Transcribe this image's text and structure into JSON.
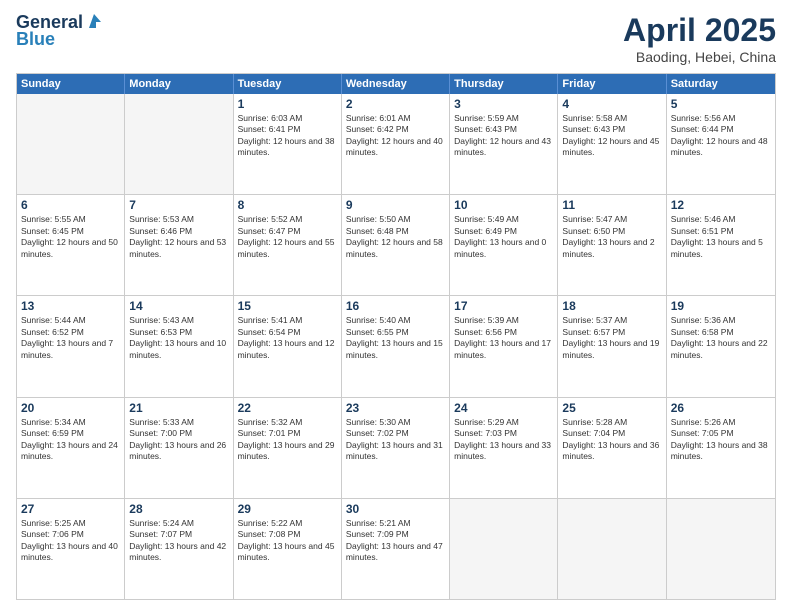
{
  "header": {
    "logo_line1": "General",
    "logo_line2": "Blue",
    "month_title": "April 2025",
    "location": "Baoding, Hebei, China"
  },
  "days_of_week": [
    "Sunday",
    "Monday",
    "Tuesday",
    "Wednesday",
    "Thursday",
    "Friday",
    "Saturday"
  ],
  "weeks": [
    [
      {
        "day": "",
        "empty": true
      },
      {
        "day": "",
        "empty": true
      },
      {
        "day": "1",
        "sunrise": "Sunrise: 6:03 AM",
        "sunset": "Sunset: 6:41 PM",
        "daylight": "Daylight: 12 hours and 38 minutes."
      },
      {
        "day": "2",
        "sunrise": "Sunrise: 6:01 AM",
        "sunset": "Sunset: 6:42 PM",
        "daylight": "Daylight: 12 hours and 40 minutes."
      },
      {
        "day": "3",
        "sunrise": "Sunrise: 5:59 AM",
        "sunset": "Sunset: 6:43 PM",
        "daylight": "Daylight: 12 hours and 43 minutes."
      },
      {
        "day": "4",
        "sunrise": "Sunrise: 5:58 AM",
        "sunset": "Sunset: 6:43 PM",
        "daylight": "Daylight: 12 hours and 45 minutes."
      },
      {
        "day": "5",
        "sunrise": "Sunrise: 5:56 AM",
        "sunset": "Sunset: 6:44 PM",
        "daylight": "Daylight: 12 hours and 48 minutes."
      }
    ],
    [
      {
        "day": "6",
        "sunrise": "Sunrise: 5:55 AM",
        "sunset": "Sunset: 6:45 PM",
        "daylight": "Daylight: 12 hours and 50 minutes."
      },
      {
        "day": "7",
        "sunrise": "Sunrise: 5:53 AM",
        "sunset": "Sunset: 6:46 PM",
        "daylight": "Daylight: 12 hours and 53 minutes."
      },
      {
        "day": "8",
        "sunrise": "Sunrise: 5:52 AM",
        "sunset": "Sunset: 6:47 PM",
        "daylight": "Daylight: 12 hours and 55 minutes."
      },
      {
        "day": "9",
        "sunrise": "Sunrise: 5:50 AM",
        "sunset": "Sunset: 6:48 PM",
        "daylight": "Daylight: 12 hours and 58 minutes."
      },
      {
        "day": "10",
        "sunrise": "Sunrise: 5:49 AM",
        "sunset": "Sunset: 6:49 PM",
        "daylight": "Daylight: 13 hours and 0 minutes."
      },
      {
        "day": "11",
        "sunrise": "Sunrise: 5:47 AM",
        "sunset": "Sunset: 6:50 PM",
        "daylight": "Daylight: 13 hours and 2 minutes."
      },
      {
        "day": "12",
        "sunrise": "Sunrise: 5:46 AM",
        "sunset": "Sunset: 6:51 PM",
        "daylight": "Daylight: 13 hours and 5 minutes."
      }
    ],
    [
      {
        "day": "13",
        "sunrise": "Sunrise: 5:44 AM",
        "sunset": "Sunset: 6:52 PM",
        "daylight": "Daylight: 13 hours and 7 minutes."
      },
      {
        "day": "14",
        "sunrise": "Sunrise: 5:43 AM",
        "sunset": "Sunset: 6:53 PM",
        "daylight": "Daylight: 13 hours and 10 minutes."
      },
      {
        "day": "15",
        "sunrise": "Sunrise: 5:41 AM",
        "sunset": "Sunset: 6:54 PM",
        "daylight": "Daylight: 13 hours and 12 minutes."
      },
      {
        "day": "16",
        "sunrise": "Sunrise: 5:40 AM",
        "sunset": "Sunset: 6:55 PM",
        "daylight": "Daylight: 13 hours and 15 minutes."
      },
      {
        "day": "17",
        "sunrise": "Sunrise: 5:39 AM",
        "sunset": "Sunset: 6:56 PM",
        "daylight": "Daylight: 13 hours and 17 minutes."
      },
      {
        "day": "18",
        "sunrise": "Sunrise: 5:37 AM",
        "sunset": "Sunset: 6:57 PM",
        "daylight": "Daylight: 13 hours and 19 minutes."
      },
      {
        "day": "19",
        "sunrise": "Sunrise: 5:36 AM",
        "sunset": "Sunset: 6:58 PM",
        "daylight": "Daylight: 13 hours and 22 minutes."
      }
    ],
    [
      {
        "day": "20",
        "sunrise": "Sunrise: 5:34 AM",
        "sunset": "Sunset: 6:59 PM",
        "daylight": "Daylight: 13 hours and 24 minutes."
      },
      {
        "day": "21",
        "sunrise": "Sunrise: 5:33 AM",
        "sunset": "Sunset: 7:00 PM",
        "daylight": "Daylight: 13 hours and 26 minutes."
      },
      {
        "day": "22",
        "sunrise": "Sunrise: 5:32 AM",
        "sunset": "Sunset: 7:01 PM",
        "daylight": "Daylight: 13 hours and 29 minutes."
      },
      {
        "day": "23",
        "sunrise": "Sunrise: 5:30 AM",
        "sunset": "Sunset: 7:02 PM",
        "daylight": "Daylight: 13 hours and 31 minutes."
      },
      {
        "day": "24",
        "sunrise": "Sunrise: 5:29 AM",
        "sunset": "Sunset: 7:03 PM",
        "daylight": "Daylight: 13 hours and 33 minutes."
      },
      {
        "day": "25",
        "sunrise": "Sunrise: 5:28 AM",
        "sunset": "Sunset: 7:04 PM",
        "daylight": "Daylight: 13 hours and 36 minutes."
      },
      {
        "day": "26",
        "sunrise": "Sunrise: 5:26 AM",
        "sunset": "Sunset: 7:05 PM",
        "daylight": "Daylight: 13 hours and 38 minutes."
      }
    ],
    [
      {
        "day": "27",
        "sunrise": "Sunrise: 5:25 AM",
        "sunset": "Sunset: 7:06 PM",
        "daylight": "Daylight: 13 hours and 40 minutes."
      },
      {
        "day": "28",
        "sunrise": "Sunrise: 5:24 AM",
        "sunset": "Sunset: 7:07 PM",
        "daylight": "Daylight: 13 hours and 42 minutes."
      },
      {
        "day": "29",
        "sunrise": "Sunrise: 5:22 AM",
        "sunset": "Sunset: 7:08 PM",
        "daylight": "Daylight: 13 hours and 45 minutes."
      },
      {
        "day": "30",
        "sunrise": "Sunrise: 5:21 AM",
        "sunset": "Sunset: 7:09 PM",
        "daylight": "Daylight: 13 hours and 47 minutes."
      },
      {
        "day": "",
        "empty": true
      },
      {
        "day": "",
        "empty": true
      },
      {
        "day": "",
        "empty": true
      }
    ]
  ]
}
